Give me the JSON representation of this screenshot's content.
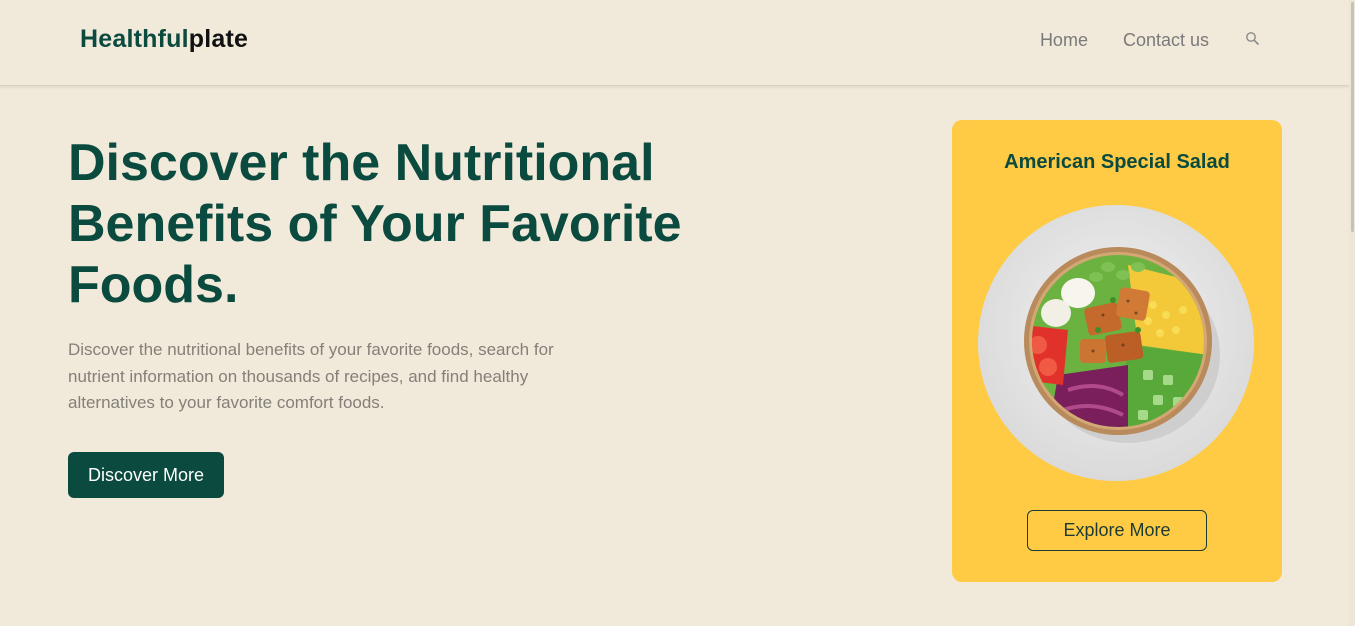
{
  "header": {
    "logo_primary": "Healthful",
    "logo_secondary": "plate",
    "nav": {
      "home": "Home",
      "contact": "Contact us"
    },
    "search_icon": "search-icon"
  },
  "hero": {
    "title": "Discover the Nutritional Benefits of Your Favorite Foods.",
    "description": "Discover the nutritional benefits of your favorite foods, search for nutrient information on thousands of recipes, and find healthy alternatives to your favorite comfort foods.",
    "cta_label": "Discover More"
  },
  "card": {
    "title": "American Special Salad",
    "image": "salad-bowl",
    "cta_label": "Explore More"
  },
  "colors": {
    "background": "#f1eadb",
    "brand_green": "#0b4a3e",
    "card_yellow": "#ffcb44",
    "muted_text": "#848079"
  }
}
